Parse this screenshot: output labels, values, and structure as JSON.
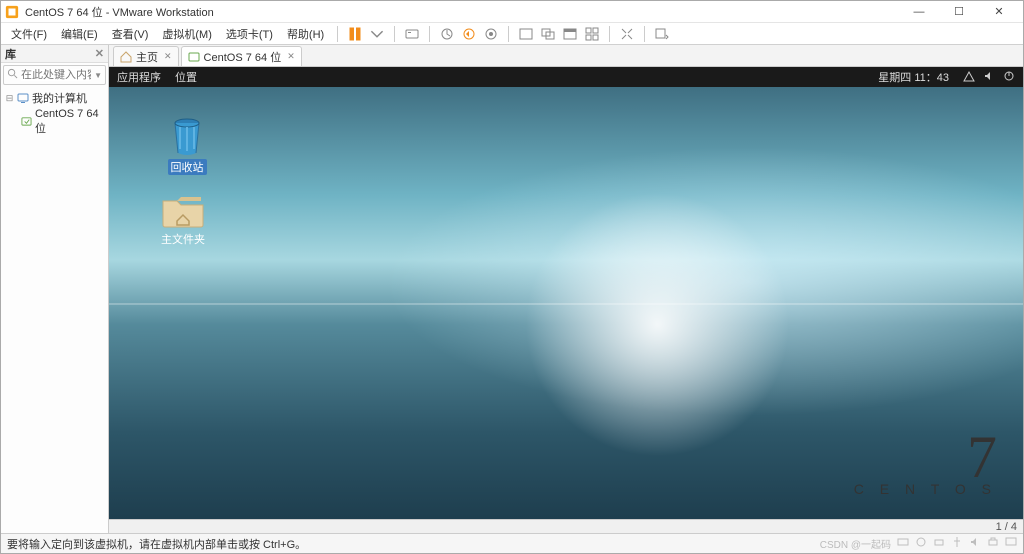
{
  "titlebar": {
    "title": "CentOS 7 64 位 - VMware Workstation"
  },
  "menubar": {
    "file": "文件(F)",
    "edit": "编辑(E)",
    "view": "查看(V)",
    "vm": "虚拟机(M)",
    "tabs": "选项卡(T)",
    "help": "帮助(H)"
  },
  "sidebar": {
    "header": "库",
    "search_placeholder": "在此处键入内容...",
    "tree": {
      "root": "我的计算机",
      "child": "CentOS 7 64 位"
    }
  },
  "tabs": {
    "home": "主页",
    "vm": "CentOS 7 64 位"
  },
  "gnome": {
    "apps": "应用程序",
    "places": "位置",
    "clock": "星期四 11：43"
  },
  "desktop": {
    "trash": "回收站",
    "home": "主文件夹",
    "brand_num": "7",
    "brand_word": "C E N T O S"
  },
  "pager": {
    "text": "1 / 4"
  },
  "statusbar": {
    "hint": "要将输入定向到该虚拟机，请在虚拟机内部单击或按 Ctrl+G。",
    "watermark": "CSDN @一起码"
  }
}
